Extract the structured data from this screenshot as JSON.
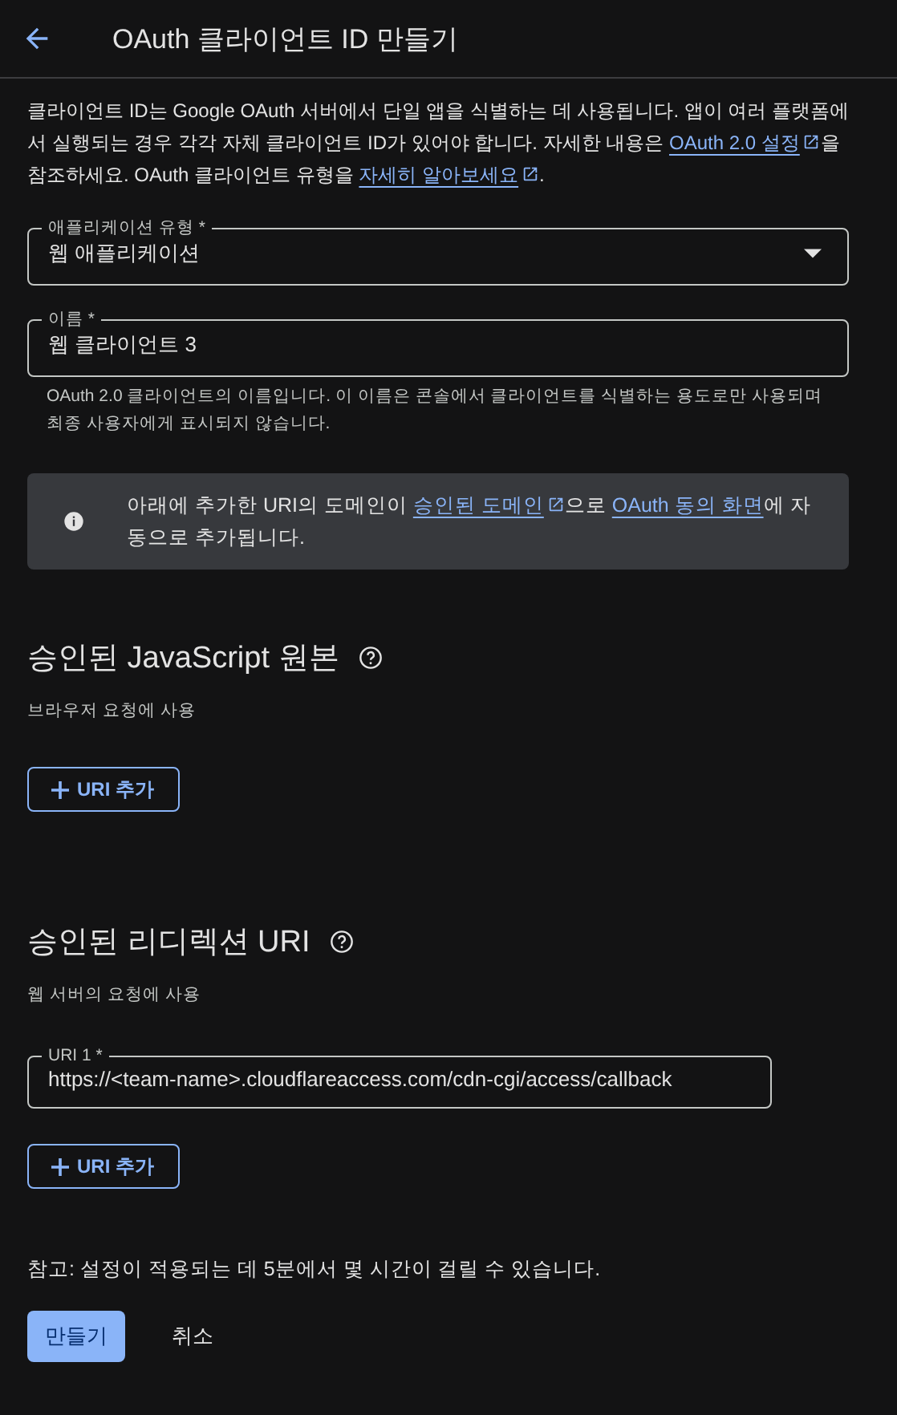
{
  "header": {
    "title": "OAuth 클라이언트 ID 만들기"
  },
  "intro": [
    {
      "kind": "text",
      "text": "클라이언트 ID는 Google OAuth 서버에서 단일 앱을 식별하는 데 사용됩니다. 앱이 여러 플랫폼에서 실행되는 경우 각각 자체 클라이언트 ID가 있어야 합니다. 자세한 내용은 "
    },
    {
      "kind": "link",
      "text": "OAuth 2.0 설정"
    },
    {
      "kind": "text",
      "text": "을 참조하세요. OAuth 클라이언트 유형을 "
    },
    {
      "kind": "link",
      "text": "자세히 알아보세요"
    },
    {
      "kind": "text",
      "text": "."
    }
  ],
  "app_type": {
    "label": "애플리케이션 유형 *",
    "value": "웹 애플리케이션"
  },
  "name_field": {
    "label": "이름 *",
    "value": "웹 클라이언트 3",
    "helper": "OAuth 2.0 클라이언트의 이름입니다. 이 이름은 콘솔에서 클라이언트를 식별하는 용도로만 사용되며 최종 사용자에게 표시되지 않습니다."
  },
  "info": [
    {
      "kind": "text",
      "text": "아래에 추가한 URI의 도메인이 "
    },
    {
      "kind": "link",
      "text": "승인된 도메인"
    },
    {
      "kind": "text",
      "text": "으로 "
    },
    {
      "kind": "plainlink",
      "text": "OAuth 동의 화면"
    },
    {
      "kind": "text",
      "text": "에 자동으로 추가됩니다."
    }
  ],
  "sections": [
    {
      "title": "승인된 JavaScript 원본",
      "subtitle": "브라우저 요청에 사용",
      "add_button": "URI 추가"
    },
    {
      "title": "승인된 리디렉션 URI",
      "subtitle": "웹 서버의 요청에 사용",
      "uris": [
        {
          "label": "URI 1 *",
          "value": "https://<team-name>.cloudflareaccess.com/cdn-cgi/access/callback"
        }
      ],
      "add_button": "URI 추가"
    }
  ],
  "note": "참고: 설정이 적용되는 데 5분에서 몇 시간이 걸릴 수 있습니다.",
  "buttons": [
    {
      "label": "만들기",
      "kind": "primary"
    },
    {
      "label": "취소",
      "kind": "text"
    }
  ]
}
